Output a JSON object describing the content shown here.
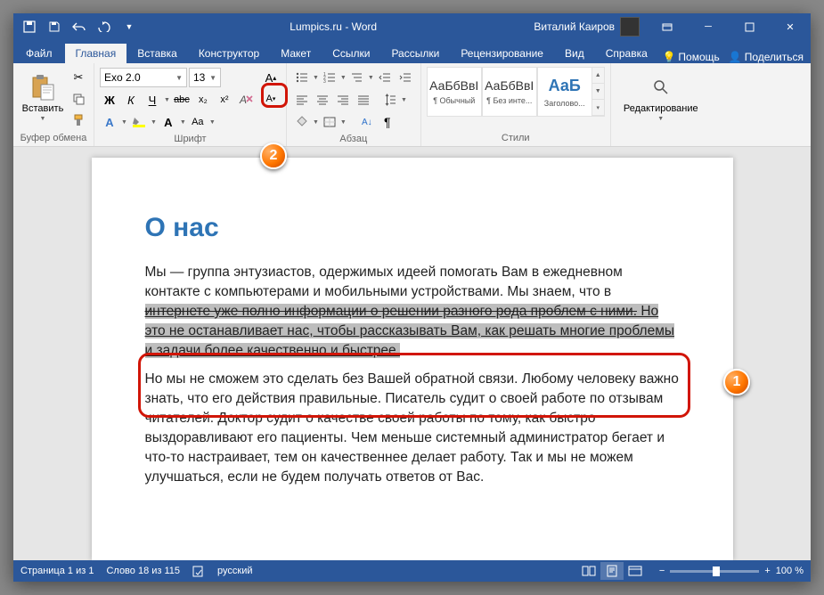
{
  "title": "Lumpics.ru - Word",
  "user": "Виталий Каиров",
  "tabs": {
    "file": "Файл",
    "home": "Главная",
    "insert": "Вставка",
    "design": "Конструктор",
    "layout": "Макет",
    "references": "Ссылки",
    "mailings": "Рассылки",
    "review": "Рецензирование",
    "view": "Вид",
    "help": "Справка"
  },
  "ribbon_right": {
    "tell_me": "Помощь",
    "share": "Поделиться"
  },
  "groups": {
    "clipboard": {
      "label": "Буфер обмена",
      "paste": "Вставить"
    },
    "font": {
      "label": "Шрифт",
      "name": "Exo 2.0",
      "size": "13",
      "bold": "Ж",
      "italic": "К",
      "underline": "Ч",
      "strike": "abc",
      "sub": "x₂",
      "sup": "x²"
    },
    "paragraph": {
      "label": "Абзац"
    },
    "styles": {
      "label": "Стили",
      "preview": "АаБбВвІ",
      "preview_heading": "АаБ",
      "normal": "¶ Обычный",
      "no_spacing": "¶ Без инте...",
      "heading1": "Заголово..."
    },
    "editing": {
      "label": "Редактирование"
    }
  },
  "document": {
    "heading": "О нас",
    "p1a": "Мы — группа энтузиастов, одержимых идеей помогать Вам в ежедневном контакте с компьютерами и мобильными устройствами. Мы знаем, что в ",
    "p1_strike": "интернете уже полно информации о решении разного рода проблем с ними.",
    "p1_sel": " Но это не останавливает нас, чтобы рассказывать Вам, как решать многие проблемы и задачи более качественно и быстрее.",
    "p2": "Но мы не сможем это сделать без Вашей обратной связи. Любому человеку важно знать, что его действия правильные. Писатель судит о своей работе по отзывам читателей. Доктор судит о качестве своей работы по тому, как быстро выздоравливают его пациенты. Чем меньше системный администратор бегает и что-то настраивает, тем он качественнее делает работу. Так и мы не можем улучшаться, если не будем получать ответов от Вас."
  },
  "status": {
    "page": "Страница 1 из 1",
    "words": "Слово 18 из 115",
    "lang": "русский",
    "zoom": "100 %"
  },
  "callouts": {
    "one": "1",
    "two": "2"
  }
}
